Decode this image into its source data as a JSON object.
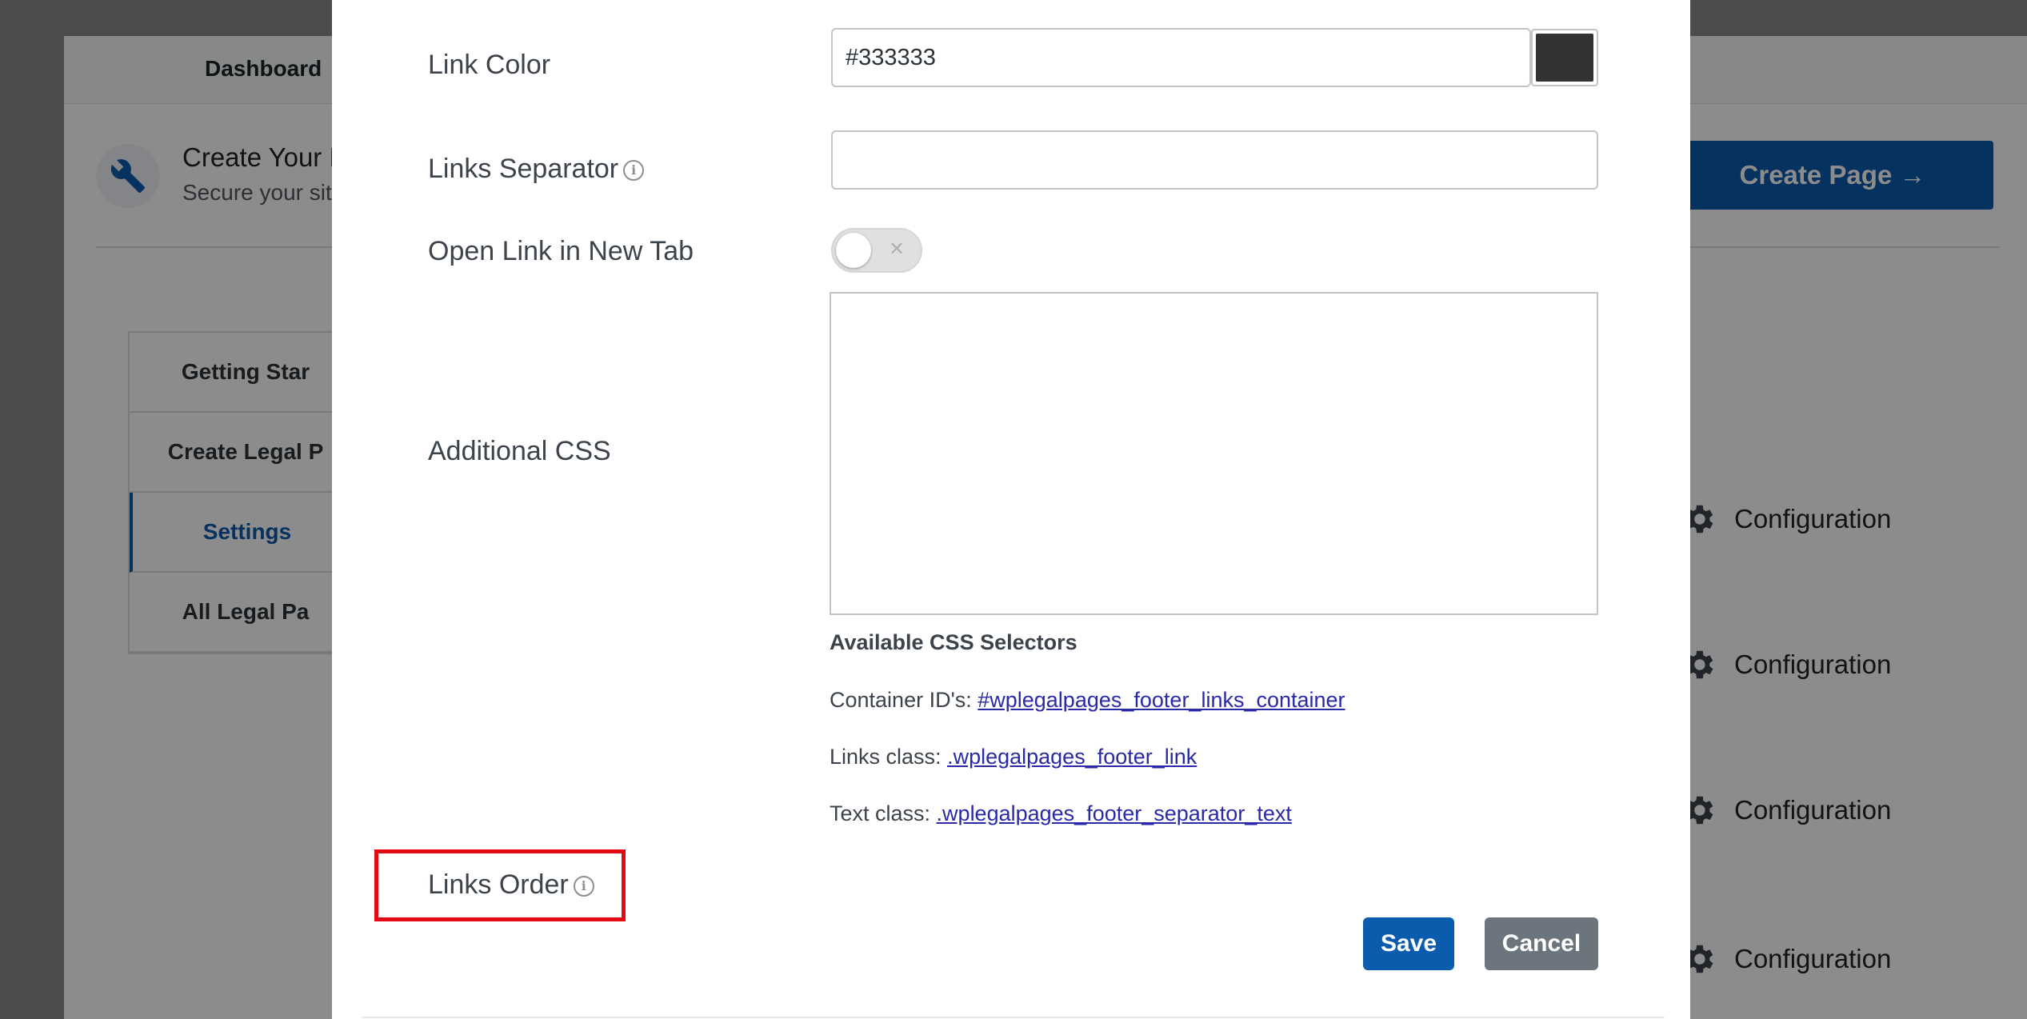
{
  "background": {
    "top_tab": "Dashboard",
    "hero_title": "Create Your L",
    "hero_subtitle": "Secure your sit",
    "create_button": "Create Page →",
    "side_nav": [
      "Getting Star",
      "Create Legal P",
      "Settings",
      "All Legal Pa"
    ],
    "config_labels": [
      "Configuration",
      "Configuration",
      "Configuration",
      "Configuration"
    ]
  },
  "modal": {
    "link_color": {
      "label": "Link Color",
      "value": "#333333",
      "swatch_color": "#333333"
    },
    "links_separator": {
      "label": "Links Separator",
      "value": ""
    },
    "open_new_tab": {
      "label": "Open Link in New Tab",
      "toggle_state": "off",
      "toggle_glyph": "✕"
    },
    "additional_css": {
      "label": "Additional CSS",
      "value": ""
    },
    "selectors": {
      "title": "Available CSS Selectors",
      "container_prefix": "Container ID's: ",
      "container_link": "#wplegalpages_footer_links_container",
      "links_prefix": "Links class: ",
      "links_link": ".wplegalpages_footer_link",
      "text_prefix": "Text class: ",
      "text_link": ".wplegalpages_footer_separator_text"
    },
    "links_order": {
      "label": "Links Order"
    },
    "info_glyph": "i",
    "save_label": "Save",
    "cancel_label": "Cancel"
  },
  "colors": {
    "accent": "#0b5cad",
    "cancel": "#6c757d",
    "highlight": "#e50914",
    "link": "#2a2aa8"
  }
}
